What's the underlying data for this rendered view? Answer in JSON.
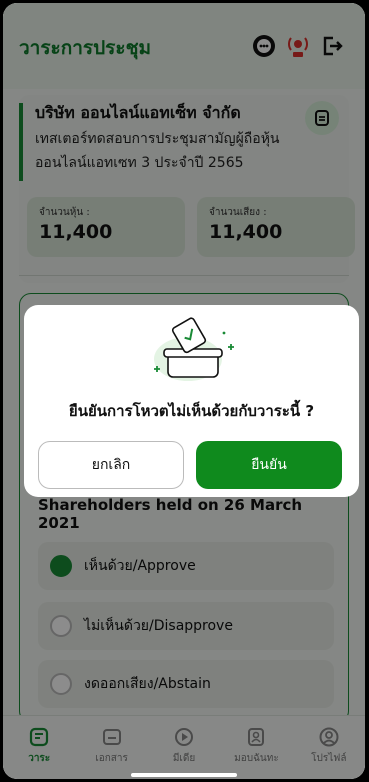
{
  "header": {
    "title": "วาระการประชุม"
  },
  "company": {
    "name": "บริษัท ออนไลน์แอทเซ็ท จำกัด",
    "description": "เทสเตอร์ทดสอบการประชุมสามัญผู้ถือหุ้นออนไลน์แอทเซท 3 ประจำปี 2565"
  },
  "stats": {
    "shares_label": "จำนวนหุ้น :",
    "shares_value": "11,400",
    "votes_label": "จำนวนเสียง :",
    "votes_value": "11,400"
  },
  "agenda": {
    "title": "Shareholders held on 26 March 2021",
    "options": [
      {
        "label": "เห็นด้วย/Approve",
        "selected": true
      },
      {
        "label": "ไม่เห็นด้วย/Disapprove",
        "selected": false
      },
      {
        "label": "งดออกเสียง/Abstain",
        "selected": false
      }
    ]
  },
  "modal": {
    "question": "ยืนยันการโหวตไม่เห็นด้วยกับวาระนี้ ?",
    "cancel_label": "ยกเลิก",
    "confirm_label": "ยืนยัน"
  },
  "nav": {
    "items": [
      {
        "label": "วาระ",
        "icon": "agenda-icon"
      },
      {
        "label": "เอกสาร",
        "icon": "folder-icon"
      },
      {
        "label": "มีเดีย",
        "icon": "play-icon"
      },
      {
        "label": "มอบฉันทะ",
        "icon": "proxy-icon"
      },
      {
        "label": "โปรไฟล์",
        "icon": "profile-icon"
      }
    ]
  },
  "colors": {
    "primary": "#198a36",
    "confirm": "#0f8a1d",
    "live": "#d9302c"
  }
}
